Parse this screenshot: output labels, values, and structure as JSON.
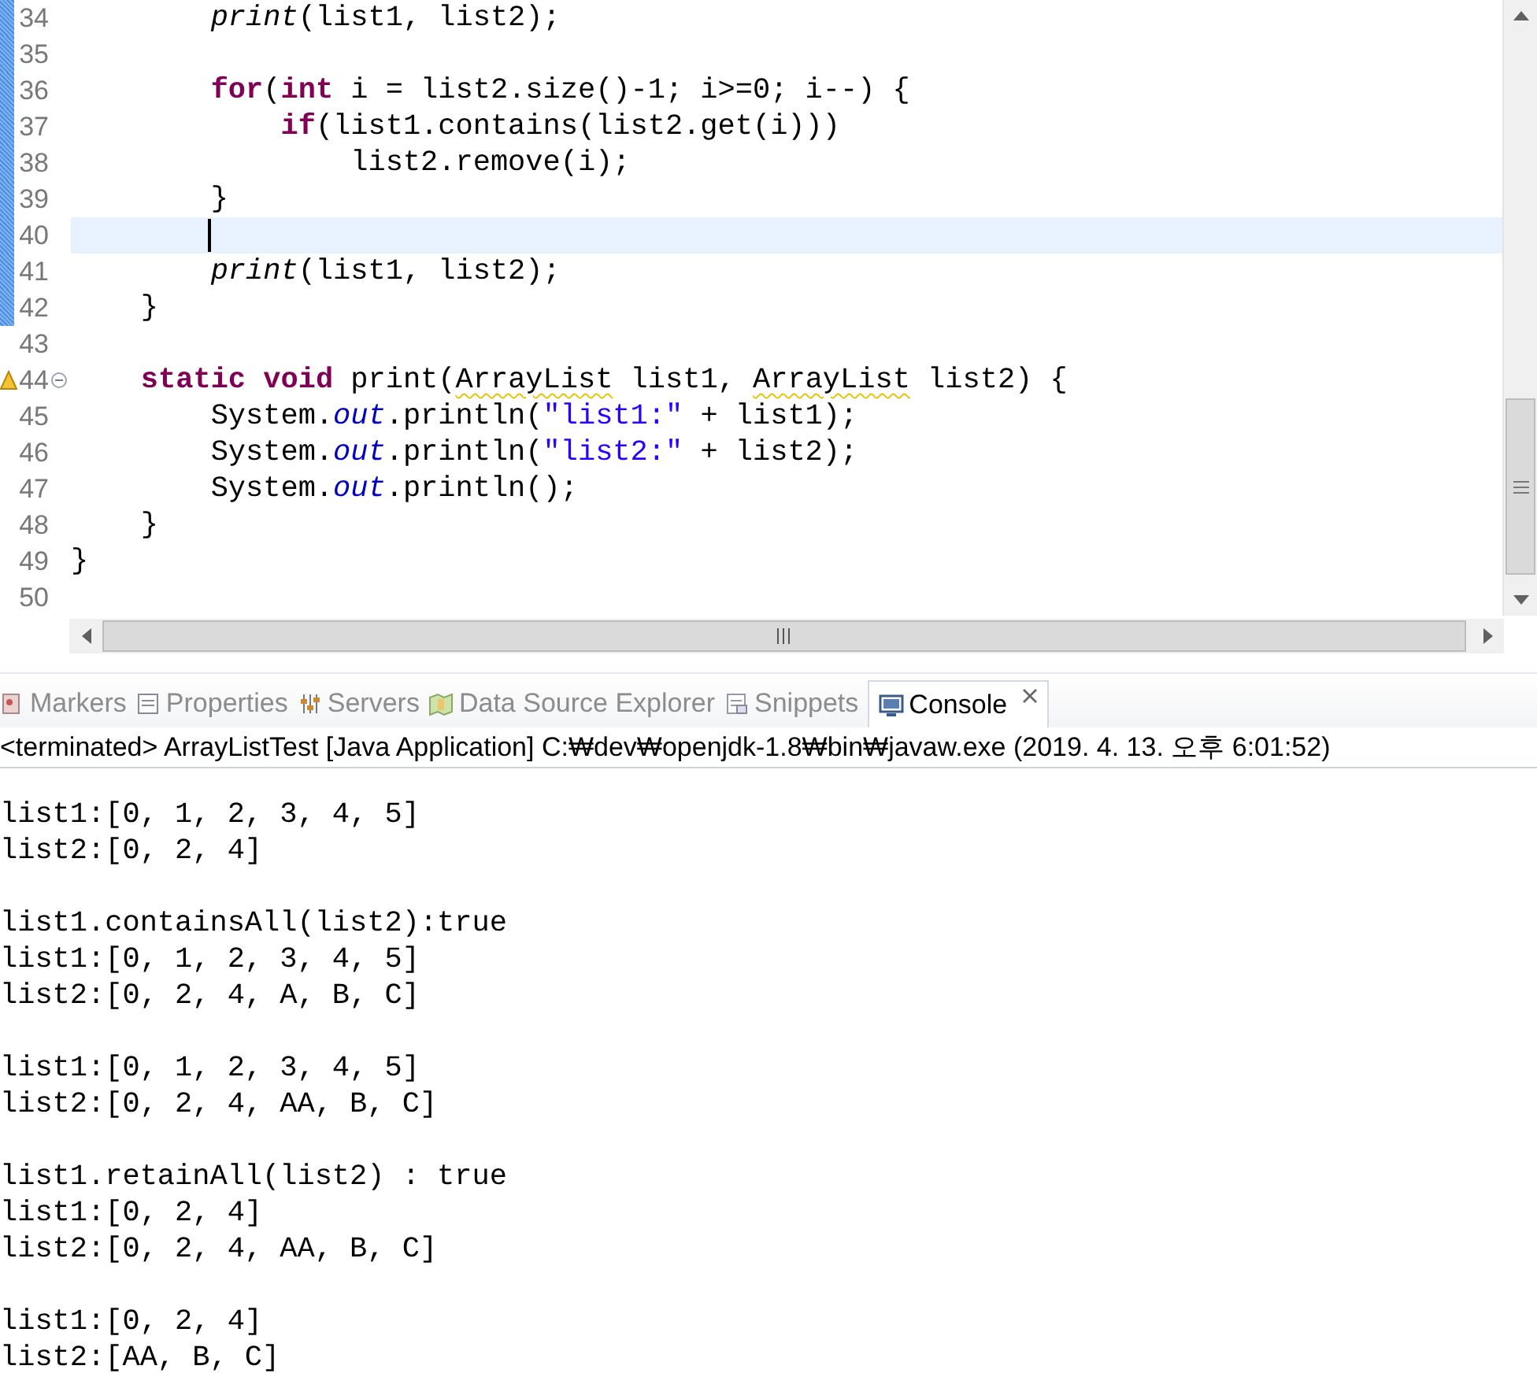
{
  "editor": {
    "lines": [
      {
        "number": "34",
        "changed": true,
        "current": false,
        "warning": false,
        "fold": false,
        "tokens": [
          {
            "text": "        print",
            "kind": "italic"
          },
          {
            "text": "(list1, list2);"
          }
        ]
      },
      {
        "number": "35",
        "changed": true,
        "current": false,
        "warning": false,
        "fold": false
      },
      {
        "number": "36",
        "changed": true,
        "current": false,
        "warning": false,
        "fold": false,
        "tokens": [
          {
            "text": "        for",
            "kind": "keyword"
          },
          {
            "text": "("
          },
          {
            "text": "int",
            "kind": "keyword"
          },
          {
            "text": " i = list2.size()-1; i>=0; i--) {"
          }
        ]
      },
      {
        "number": "37",
        "changed": true,
        "current": false,
        "warning": false,
        "fold": false,
        "tokens": [
          {
            "text": "            if",
            "kind": "keyword"
          },
          {
            "text": "(list1.contains(list2.get(i)))"
          }
        ]
      },
      {
        "number": "38",
        "changed": true,
        "current": false,
        "warning": false,
        "fold": false,
        "tokens": [
          {
            "text": "                list2.remove(i);"
          }
        ]
      },
      {
        "number": "39",
        "changed": true,
        "current": false,
        "warning": false,
        "fold": false,
        "tokens": [
          {
            "text": "        }"
          }
        ]
      },
      {
        "number": "40",
        "changed": true,
        "current": true,
        "warning": false,
        "fold": false
      },
      {
        "number": "41",
        "changed": true,
        "current": false,
        "warning": false,
        "fold": false,
        "tokens": [
          {
            "text": "        print",
            "kind": "italic"
          },
          {
            "text": "(list1, list2);"
          }
        ]
      },
      {
        "number": "42",
        "changed": true,
        "current": false,
        "warning": false,
        "fold": false,
        "tokens": [
          {
            "text": "    }"
          }
        ]
      },
      {
        "number": "43",
        "changed": false,
        "current": false,
        "warning": false,
        "fold": false
      },
      {
        "number": "44",
        "changed": false,
        "current": false,
        "warning": true,
        "fold": true,
        "tokens": [
          {
            "text": "    static",
            "kind": "keyword"
          },
          {
            "text": " void",
            "kind": "keyword"
          },
          {
            "text": " print("
          },
          {
            "text": "ArrayList",
            "kind": "warn"
          },
          {
            "text": " list1, "
          },
          {
            "text": "ArrayList",
            "kind": "warn"
          },
          {
            "text": " list2) {"
          }
        ]
      },
      {
        "number": "45",
        "changed": false,
        "current": false,
        "warning": false,
        "fold": false,
        "tokens": [
          {
            "text": "        System."
          },
          {
            "text": "out",
            "kind": "field"
          },
          {
            "text": ".println("
          },
          {
            "text": "\"list1:\"",
            "kind": "string"
          },
          {
            "text": " + list1);"
          }
        ]
      },
      {
        "number": "46",
        "changed": false,
        "current": false,
        "warning": false,
        "fold": false,
        "tokens": [
          {
            "text": "        System."
          },
          {
            "text": "out",
            "kind": "field"
          },
          {
            "text": ".println("
          },
          {
            "text": "\"list2:\"",
            "kind": "string"
          },
          {
            "text": " + list2);"
          }
        ]
      },
      {
        "number": "47",
        "changed": false,
        "current": false,
        "warning": false,
        "fold": false,
        "tokens": [
          {
            "text": "        System."
          },
          {
            "text": "out",
            "kind": "field"
          },
          {
            "text": ".println();"
          }
        ]
      },
      {
        "number": "48",
        "changed": false,
        "current": false,
        "warning": false,
        "fold": false,
        "tokens": [
          {
            "text": "    }"
          }
        ]
      },
      {
        "number": "49",
        "changed": false,
        "current": false,
        "warning": false,
        "fold": false,
        "tokens": [
          {
            "text": "}"
          }
        ]
      },
      {
        "number": "50",
        "changed": false,
        "current": false,
        "warning": false,
        "fold": false
      }
    ]
  },
  "view_tabs": [
    {
      "label": "Markers",
      "selected": false,
      "kind": "markers"
    },
    {
      "label": "Properties",
      "selected": false,
      "kind": "properties"
    },
    {
      "label": "Servers",
      "selected": false,
      "kind": "servers"
    },
    {
      "label": "Data Source Explorer",
      "selected": false,
      "kind": "datasource"
    },
    {
      "label": "Snippets",
      "selected": false,
      "kind": "snippets"
    },
    {
      "label": "Console",
      "selected": true,
      "kind": "console"
    }
  ],
  "console": {
    "status": "<terminated> ArrayListTest [Java Application] C:₩dev₩openjdk-1.8₩bin₩javaw.exe (2019. 4. 13. 오후 6:01:52)",
    "output_blocks": [
      [
        "list1:[0, 1, 2, 3, 4, 5]",
        "list2:[0, 2, 4]"
      ],
      [
        "list1.containsAll(list2):true",
        "list1:[0, 1, 2, 3, 4, 5]",
        "list2:[0, 2, 4, A, B, C]"
      ],
      [
        "list1:[0, 1, 2, 3, 4, 5]",
        "list2:[0, 2, 4, AA, B, C]"
      ],
      [
        "list1.retainAll(list2) : true",
        "list1:[0, 2, 4]",
        "list2:[0, 2, 4, AA, B, C]"
      ],
      [
        "list1:[0, 2, 4]",
        "list2:[AA, B, C]"
      ]
    ]
  }
}
